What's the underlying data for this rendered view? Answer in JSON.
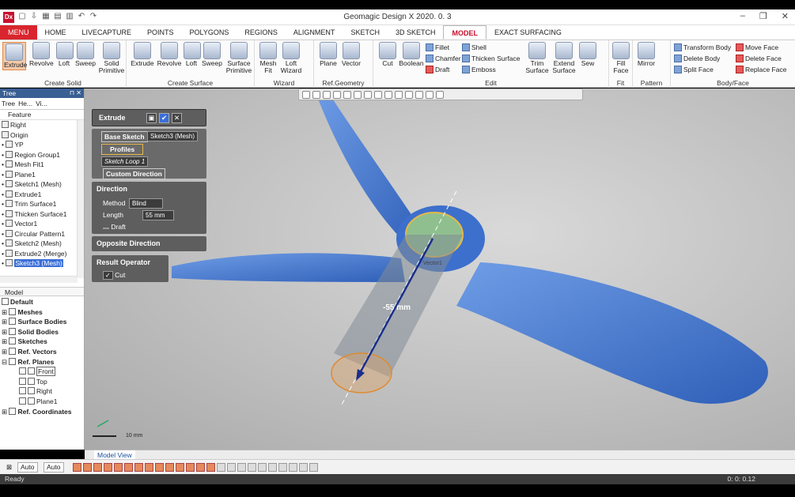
{
  "app": {
    "title": "Geomagic Design X 2020. 0. 3",
    "logo": "Dx"
  },
  "menu": {
    "tabs": [
      "MENU",
      "HOME",
      "LIVECAPTURE",
      "POINTS",
      "POLYGONS",
      "REGIONS",
      "ALIGNMENT",
      "SKETCH",
      "3D SKETCH",
      "MODEL",
      "EXACT SURFACING"
    ],
    "active": "MODEL"
  },
  "ribbon": {
    "create_solid": {
      "label": "Create Solid",
      "buttons": [
        "Extrude",
        "Revolve",
        "Loft",
        "Sweep",
        "Solid\nPrimitive"
      ]
    },
    "create_surface": {
      "label": "Create Surface",
      "buttons": [
        "Extrude",
        "Revolve",
        "Loft",
        "Sweep",
        "Surface\nPrimitive"
      ]
    },
    "wizard": {
      "label": "Wizard",
      "buttons": [
        "Mesh\nFit",
        "Loft\nWizard"
      ]
    },
    "ref_geometry": {
      "label": "Ref.Geometry",
      "buttons": [
        "Plane",
        "Vector"
      ]
    },
    "edit": {
      "label": "Edit",
      "buttons": [
        "Cut",
        "Boolean"
      ],
      "small": [
        "Fillet",
        "Chamfer",
        "Draft",
        "Shell",
        "Thicken Surface",
        "Emboss"
      ],
      "big2": [
        "Trim\nSurface",
        "Extend\nSurface",
        "Sew"
      ]
    },
    "fit": {
      "label": "Fit",
      "buttons": [
        "Fill\nFace"
      ]
    },
    "pattern": {
      "label": "Pattern",
      "buttons": [
        "Mirror"
      ]
    },
    "body_face": {
      "label": "Body/Face",
      "small": [
        "Transform Body",
        "Delete Body",
        "Split Face",
        "Move Face",
        "Delete Face",
        "Replace Face"
      ]
    }
  },
  "tree": {
    "header": "Tree",
    "tabs": [
      "Tree",
      "He...",
      "Vi..."
    ],
    "feature_label": "Feature",
    "items": [
      "Right",
      "Origin",
      "YP",
      "Region Group1",
      "Mesh Fit1",
      "Plane1",
      "Sketch1 (Mesh)",
      "Extrude1",
      "Trim Surface1",
      "Thicken Surface1",
      "Vector1",
      "Circular Pattern1",
      "Sketch2 (Mesh)",
      "Extrude2 (Merge)",
      "Sketch3 (Mesh)"
    ],
    "selected": "Sketch3 (Mesh)"
  },
  "model": {
    "header": "Model",
    "default": "Default",
    "groups": [
      "Meshes",
      "Surface Bodies",
      "Solid Bodies",
      "Sketches",
      "Ref. Vectors",
      "Ref. Planes"
    ],
    "planes": [
      "Front",
      "Top",
      "Right",
      "Plane1"
    ],
    "coords": "Ref. Coordinates"
  },
  "extrude": {
    "title": "Extrude",
    "base_sketch_label": "Base Sketch",
    "base_sketch_value": "Sketch3 (Mesh)",
    "profiles_label": "Profiles",
    "profile_item": "Sketch Loop 1",
    "custom_direction": "Custom Direction",
    "direction_header": "Direction",
    "method_label": "Method",
    "method_value": "Blind",
    "length_label": "Length",
    "length_value": "55 mm",
    "draft_label": "Draft",
    "opposite_direction": "Opposite Direction",
    "result_operator": "Result Operator",
    "cut_label": "Cut"
  },
  "viewport": {
    "dimension": "-55 mm",
    "vector_label": "Vector1",
    "scale": "10 mm"
  },
  "bottom": {
    "model_view": "Model View",
    "auto1": "Auto",
    "auto2": "Auto"
  },
  "status": {
    "text": "Ready",
    "coords": "0: 0: 0.12"
  },
  "colors": {
    "accent": "#d9252d",
    "blade": "#4a7fd4",
    "dialog": "#5e5e5e"
  }
}
